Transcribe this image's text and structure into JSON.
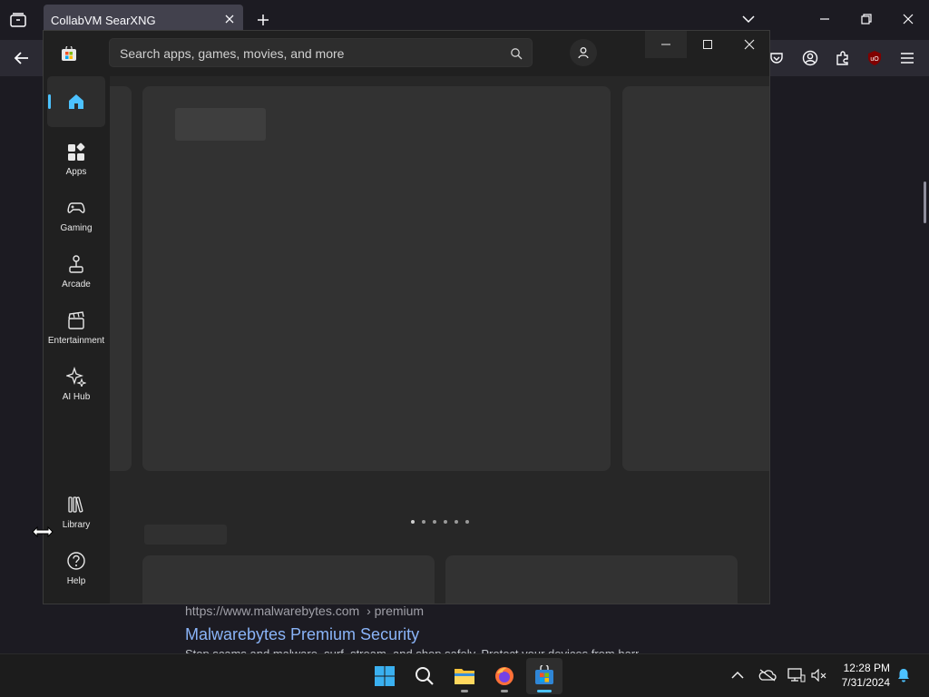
{
  "browser": {
    "tab_title": "CollabVM SearXNG"
  },
  "search_result": {
    "url": "https://www.malwarebytes.com",
    "breadcrumb": "› premium",
    "title": "Malwarebytes Premium Security",
    "snippet": "Stop scams and malware, surf, stream, and shop safely. Protect your devices from harmful files for"
  },
  "store": {
    "search_placeholder": "Search apps, games, movies, and more",
    "nav": [
      {
        "label": "Home",
        "icon": "home-icon"
      },
      {
        "label": "Apps",
        "icon": "apps-icon"
      },
      {
        "label": "Gaming",
        "icon": "gamepad-icon"
      },
      {
        "label": "Arcade",
        "icon": "joystick-icon"
      },
      {
        "label": "Entertainment",
        "icon": "clapperboard-icon"
      },
      {
        "label": "AI Hub",
        "icon": "sparkle-icon"
      },
      {
        "label": "Library",
        "icon": "library-icon"
      },
      {
        "label": "Help",
        "icon": "help-icon"
      }
    ],
    "accent": "#4cc2ff"
  },
  "taskbar": {
    "time": "12:28 PM",
    "date": "7/31/2024",
    "apps": [
      "start-icon",
      "search-icon",
      "file-explorer-icon",
      "firefox-icon",
      "microsoft-store-icon"
    ]
  }
}
